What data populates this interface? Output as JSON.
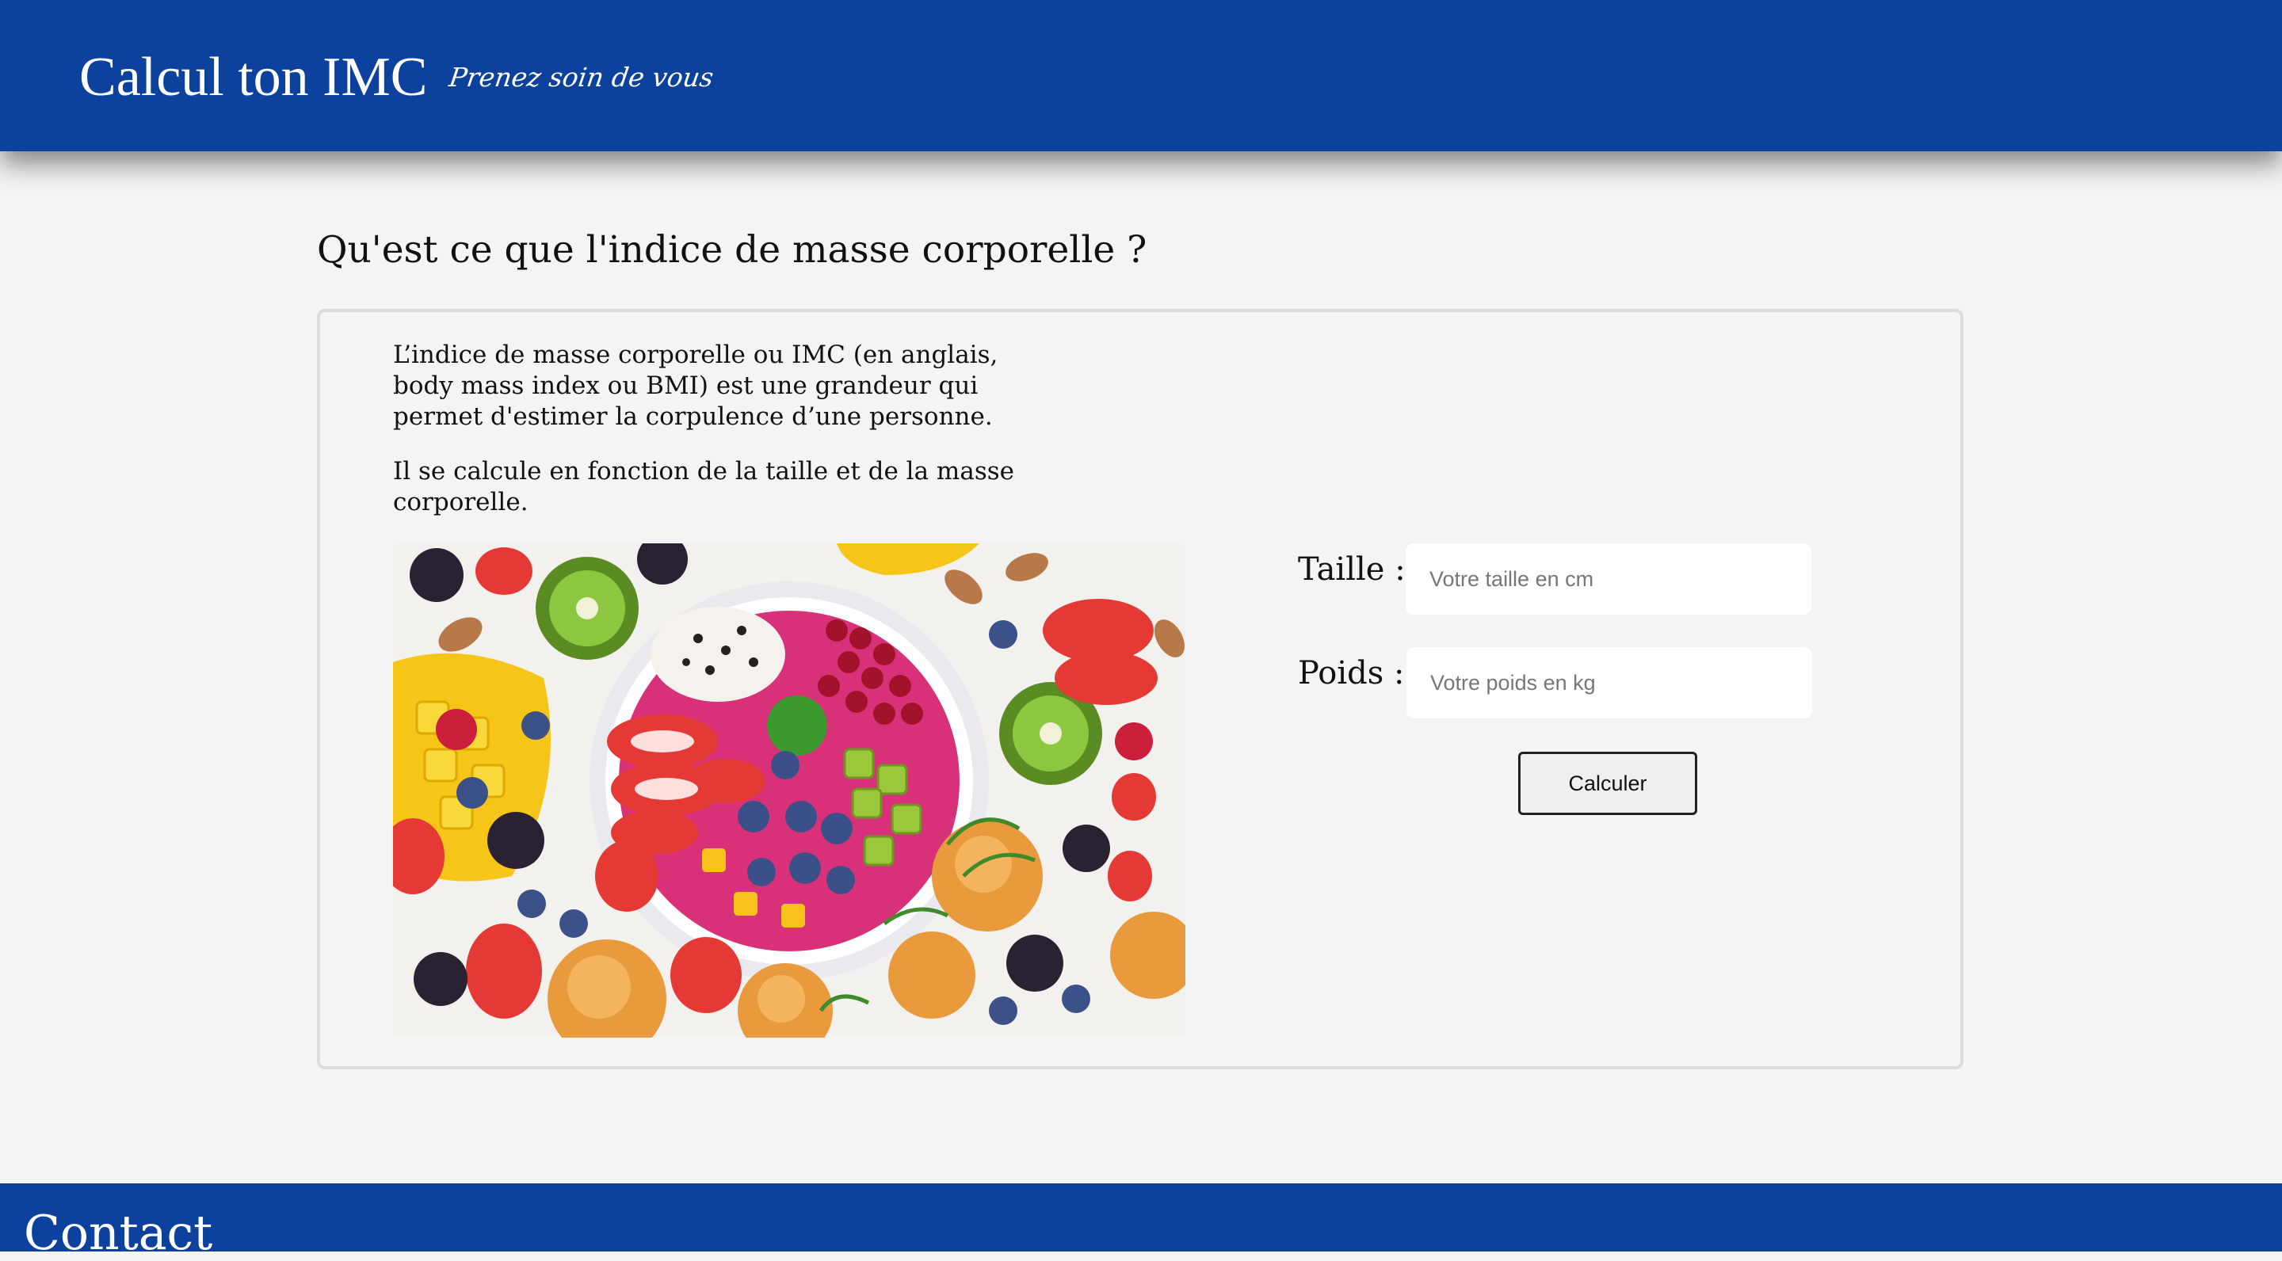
{
  "header": {
    "title": "Calcul ton IMC",
    "tagline": "Prenez soin de vous",
    "background": "#0c429d"
  },
  "main": {
    "heading": "Qu'est ce que l'indice de masse corporelle ?",
    "paragraphs": [
      "L’indice de masse corporelle ou IMC (en anglais, body mass index ou BMI) est une grandeur qui permet d'estimer la corpulence d’une personne.",
      "Il se calcule en fonction de la taille et de la masse corporelle."
    ],
    "image": "fruit-bowl-photo"
  },
  "form": {
    "height_label": "Taille :",
    "height_placeholder": "Votre taille en cm",
    "height_value": "",
    "weight_label": "Poids :",
    "weight_placeholder": "Votre poids en kg",
    "weight_value": "",
    "submit_label": "Calculer"
  },
  "footer": {
    "title": "Contact"
  }
}
